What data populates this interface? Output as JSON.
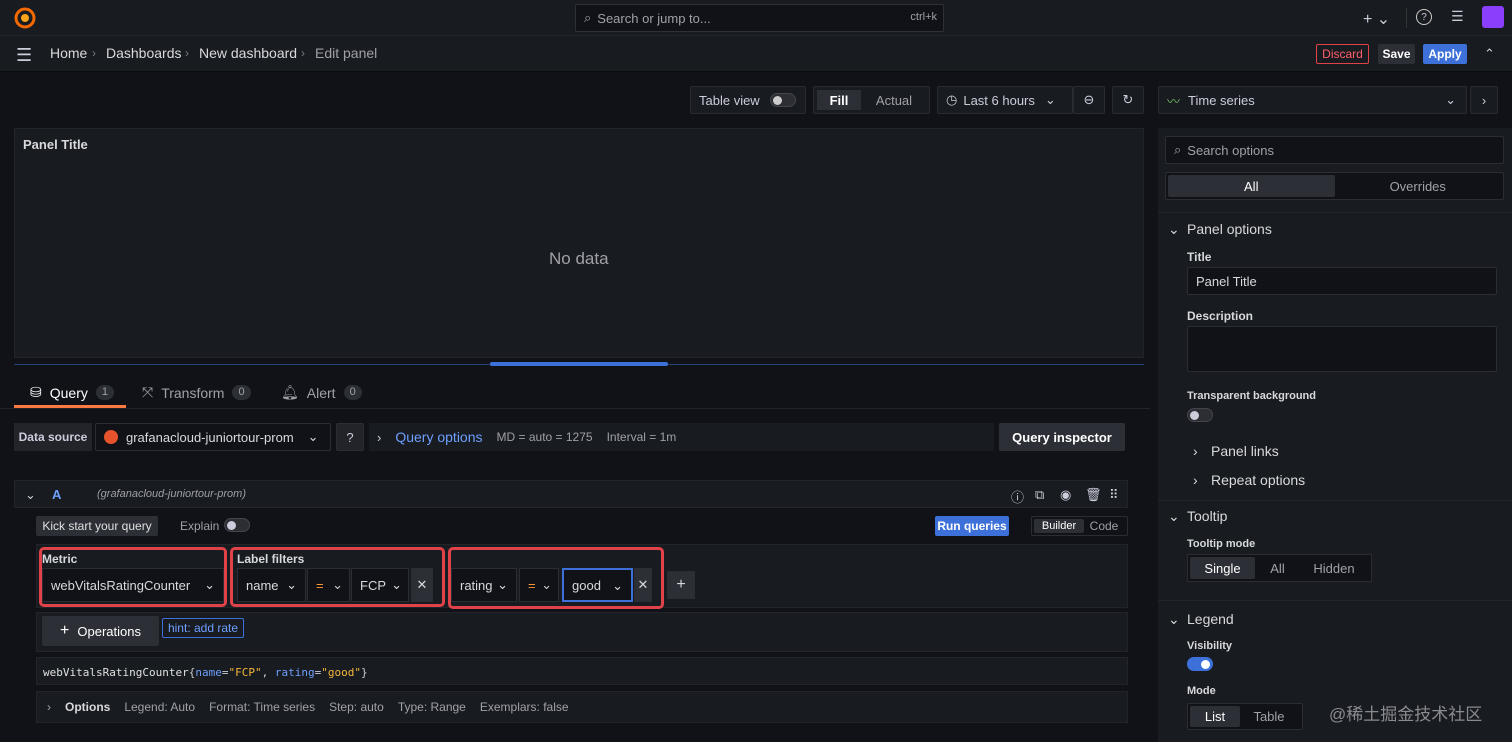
{
  "header": {
    "search_placeholder": "Search or jump to...",
    "search_shortcut": "ctrl+k"
  },
  "breadcrumbs": [
    "Home",
    "Dashboards",
    "New dashboard",
    "Edit panel"
  ],
  "actions": {
    "discard": "Discard",
    "save": "Save",
    "apply": "Apply"
  },
  "toolbar": {
    "table_view": "Table view",
    "fill": "Fill",
    "actual": "Actual",
    "time_range": "Last 6 hours"
  },
  "panel": {
    "title": "Panel Title",
    "no_data": "No data"
  },
  "tabs": [
    {
      "label": "Query",
      "count": "1"
    },
    {
      "label": "Transform",
      "count": "0"
    },
    {
      "label": "Alert",
      "count": "0"
    }
  ],
  "datasource": {
    "label": "Data source",
    "name": "grafanacloud-juniortour-prom",
    "query_options": "Query options",
    "md": "MD = auto = 1275",
    "interval": "Interval = 1m",
    "inspector": "Query inspector"
  },
  "query": {
    "ref": "A",
    "ds_hint": "(grafanacloud-juniortour-prom)",
    "kickstart": "Kick start your query",
    "explain": "Explain",
    "run": "Run queries",
    "builder": "Builder",
    "code": "Code",
    "metric_label": "Metric",
    "metric": "webVitalsRatingCounter",
    "filters_label": "Label filters",
    "filter1": {
      "key": "name",
      "op": "=",
      "value": "FCP"
    },
    "filter2": {
      "key": "rating",
      "op": "=",
      "value": "good"
    },
    "operations": "Operations",
    "hint": "hint: add rate",
    "promql_metric": "webVitalsRatingCounter",
    "promql_open": "{",
    "promql_k1": "name",
    "promql_v1": "\"FCP\"",
    "promql_comma": ", ",
    "promql_k2": "rating",
    "promql_v2": "\"good\"",
    "promql_close": "}",
    "options_label": "Options",
    "opt_legend": "Legend: Auto",
    "opt_format": "Format: Time series",
    "opt_step": "Step: auto",
    "opt_type": "Type: Range",
    "opt_exemplars": "Exemplars: false"
  },
  "sidebar": {
    "viz": "Time series",
    "search_placeholder": "Search options",
    "all": "All",
    "overrides": "Overrides",
    "panel_options": "Panel options",
    "title_label": "Title",
    "title_value": "Panel Title",
    "description_label": "Description",
    "transparent": "Transparent background",
    "panel_links": "Panel links",
    "repeat_options": "Repeat options",
    "tooltip": "Tooltip",
    "tooltip_mode": "Tooltip mode",
    "single": "Single",
    "all_mode": "All",
    "hidden": "Hidden",
    "legend": "Legend",
    "visibility": "Visibility",
    "mode": "Mode",
    "list": "List",
    "table": "Table"
  },
  "watermark": "@稀土掘金技术社区",
  "colors": {
    "accent": "#3d71d9",
    "danger": "#e0424a",
    "bg": "#111217",
    "panel": "#181b1f"
  }
}
